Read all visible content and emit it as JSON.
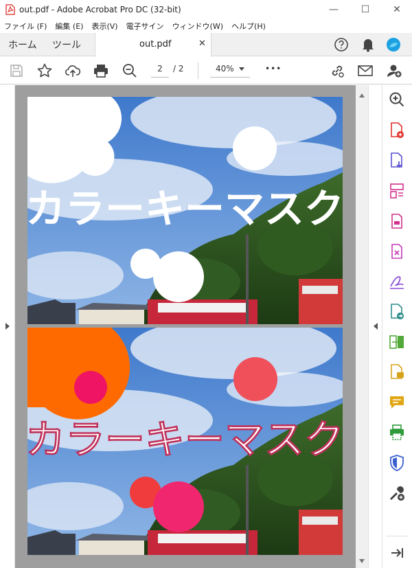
{
  "window": {
    "title": "out.pdf - Adobe Acrobat Pro DC (32-bit)",
    "controls": [
      "—",
      "☐",
      "✕"
    ]
  },
  "menu": [
    "ファイル (F)",
    "編集 (E)",
    "表示(V)",
    "電子サイン",
    "ウィンドウ(W)",
    "ヘルプ(H)"
  ],
  "tabs": {
    "home": "ホーム",
    "tools": "ツール",
    "document": "out.pdf",
    "close": "✕"
  },
  "toolbar": {
    "current_page": "2",
    "page_separator": "/",
    "total_pages": "2",
    "zoom": "40%",
    "more": "•••"
  },
  "document": {
    "page1_text": "カラーキーマスク",
    "page2_text": "カラーキーマスク"
  },
  "colors": {
    "accent": "#1473e6",
    "pdf_red": "#d9231e",
    "viewer_gray": "#9e9e9e",
    "sky": "#5b8fd6",
    "orange": "#ff6a00",
    "magenta": "#f0266e",
    "coral": "#f0505a"
  },
  "right_panel_icons": [
    "zoom-tool-icon",
    "create-pdf-icon",
    "export-pdf-icon",
    "organize-pages-icon",
    "edit-pdf-icon",
    "compress-pdf-icon",
    "fill-sign-icon",
    "send-for-signature-icon",
    "compare-files-icon",
    "comment-icon",
    "comment-bubble-icon",
    "print-production-icon",
    "protect-icon",
    "more-tools-icon",
    "collapse-panel-icon"
  ]
}
